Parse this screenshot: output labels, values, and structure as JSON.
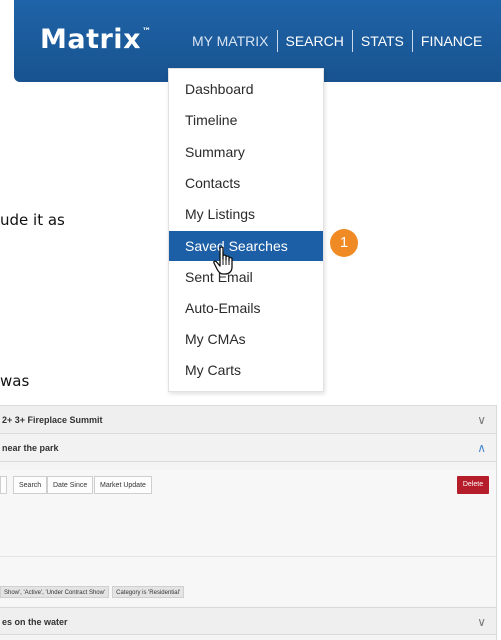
{
  "header": {
    "logo_text": "Matrix",
    "logo_tm": "™",
    "nav": [
      "MY MATRIX",
      "SEARCH",
      "STATS",
      "FINANCE"
    ]
  },
  "dropdown": {
    "items": [
      "Dashboard",
      "Timeline",
      "Summary",
      "Contacts",
      "My Listings",
      "Saved Searches",
      "Sent Email",
      "Auto-Emails",
      "My CMAs",
      "My Carts"
    ],
    "selected": "Saved Searches"
  },
  "step_badge": "1",
  "body_fragments": {
    "line1": "ude it as",
    "line2": "was"
  },
  "saved_searches": {
    "rows": [
      {
        "title": "2+ 3+ Fireplace Summit",
        "state": "collapsed"
      },
      {
        "title": "near the park",
        "state": "expanded"
      },
      {
        "title": "es on the water",
        "state": "collapsed"
      }
    ],
    "actions": [
      "Search",
      "Date Since",
      "Market Update"
    ],
    "delete_label": "Delete",
    "criteria": [
      "Show', 'Active', 'Under Contract Show'",
      "Category is 'Residential'"
    ]
  },
  "colors": {
    "header_blue": "#1a5a9b",
    "selected_blue": "#1d5fa6",
    "badge_orange": "#f08a24",
    "delete_red": "#b51d2a"
  }
}
